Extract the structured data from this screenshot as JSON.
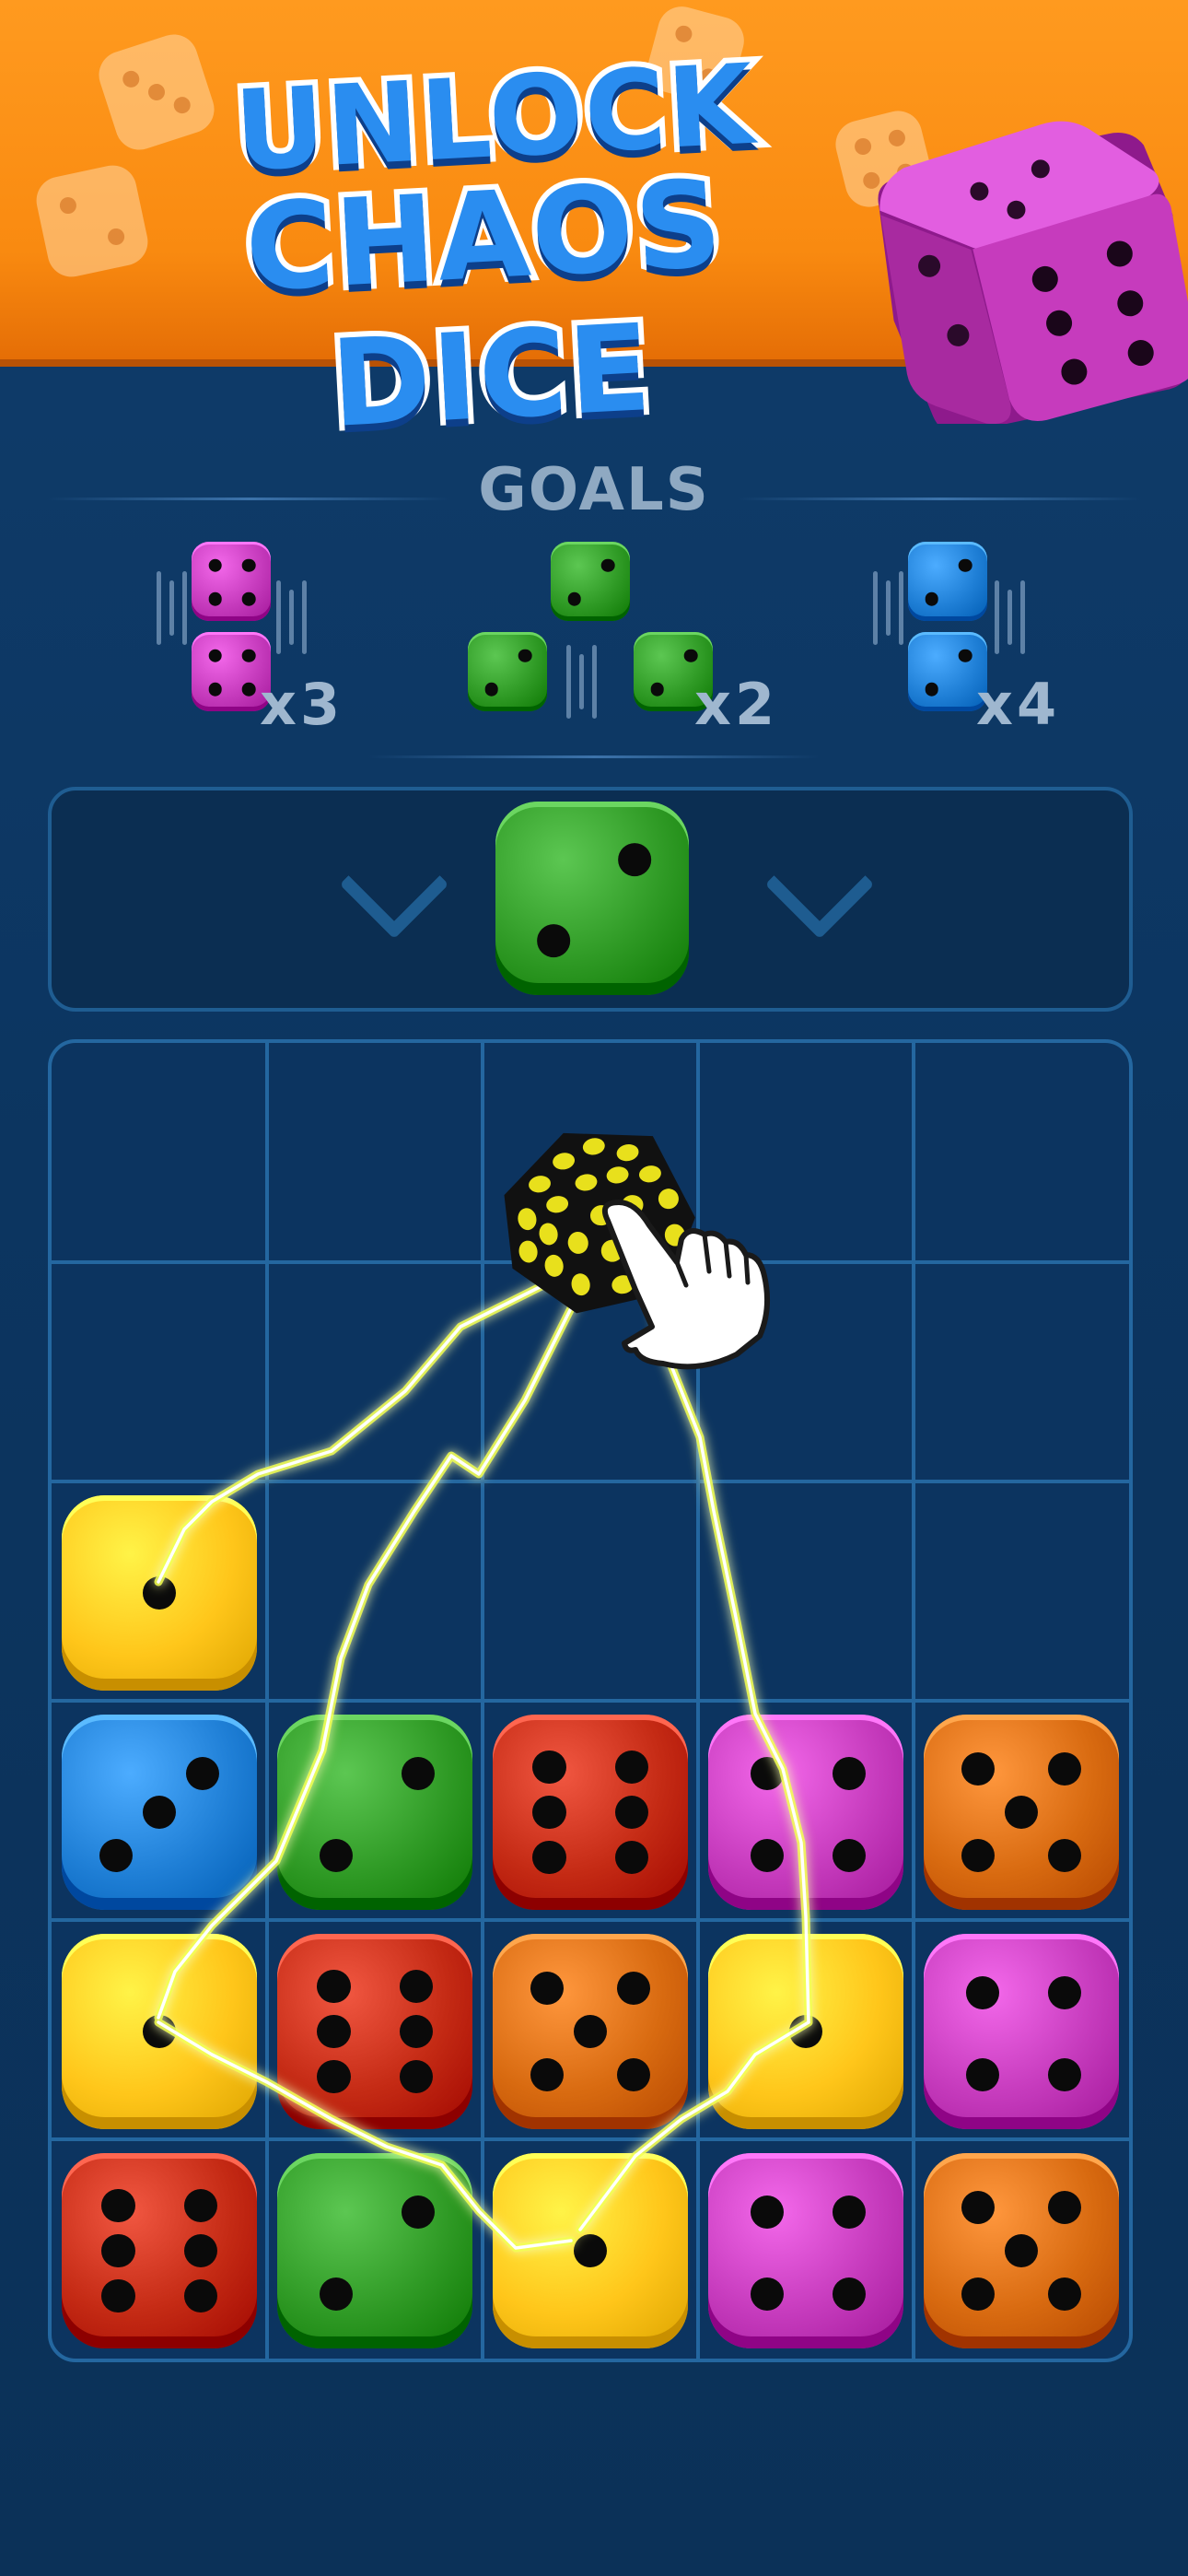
{
  "banner": {
    "line1": "UNLOCK",
    "line2": "CHAOS DICE"
  },
  "goals": {
    "label": "GOALS",
    "items": [
      {
        "color": "magenta",
        "value": 4,
        "count": "x3"
      },
      {
        "color": "green",
        "value": 2,
        "count": "x2"
      },
      {
        "color": "blue",
        "value": 2,
        "count": "x4"
      }
    ]
  },
  "next_die": {
    "color": "green",
    "value": 2
  },
  "colors": {
    "yellow": "#ffc61a",
    "blue": "#1f7fd6",
    "green": "#2f9a25",
    "red": "#c42a14",
    "orange": "#d86a10",
    "magenta": "#c63bbd",
    "chaos": "#e8e01c"
  },
  "board": {
    "rows": 6,
    "cols": 5,
    "cells": [
      [
        null,
        null,
        null,
        null,
        null
      ],
      [
        null,
        null,
        null,
        null,
        null
      ],
      [
        {
          "color": "yellow",
          "value": 1
        },
        null,
        null,
        null,
        null
      ],
      [
        {
          "color": "blue",
          "value": 3
        },
        {
          "color": "green",
          "value": 2
        },
        {
          "color": "red",
          "value": 6
        },
        {
          "color": "magenta",
          "value": 4
        },
        {
          "color": "orange",
          "value": 5
        }
      ],
      [
        {
          "color": "yellow",
          "value": 1
        },
        {
          "color": "red",
          "value": 6
        },
        {
          "color": "orange",
          "value": 5
        },
        {
          "color": "yellow",
          "value": 1
        },
        {
          "color": "magenta",
          "value": 4
        }
      ],
      [
        {
          "color": "red",
          "value": 6
        },
        {
          "color": "green",
          "value": 2
        },
        {
          "color": "yellow",
          "value": 1
        },
        {
          "color": "magenta",
          "value": 4
        },
        {
          "color": "orange",
          "value": 5
        }
      ]
    ]
  }
}
